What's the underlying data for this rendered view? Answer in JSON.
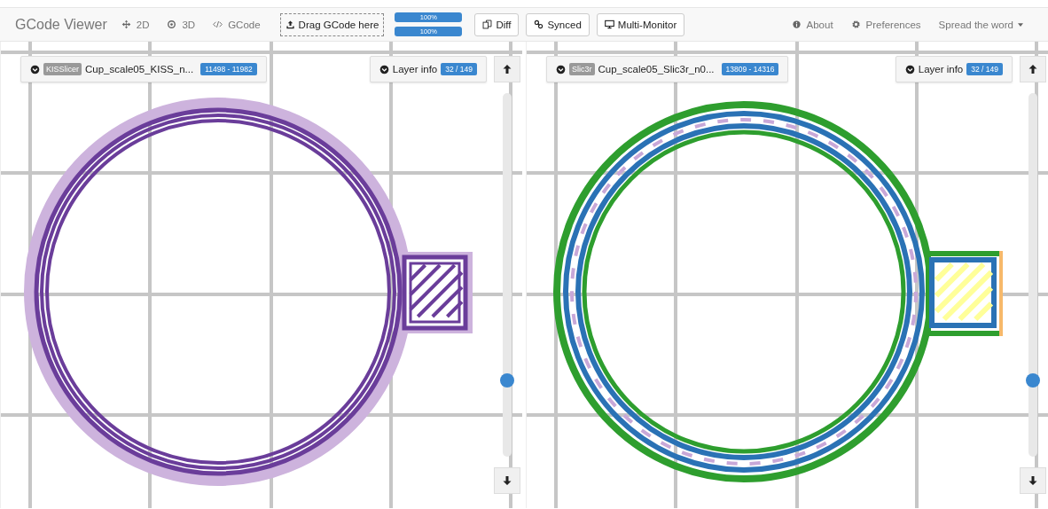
{
  "navbar": {
    "brand": "GCode Viewer",
    "nav_items": [
      {
        "label": "2D"
      },
      {
        "label": "3D"
      },
      {
        "label": "GCode"
      }
    ],
    "upload_button": "Drag GCode here",
    "progress_bars": [
      {
        "label": "100%",
        "level": 1
      },
      {
        "label": "100%",
        "level": 1
      }
    ],
    "buttons": [
      {
        "label": "Diff"
      },
      {
        "label": "Synced"
      },
      {
        "label": "Multi-Monitor"
      }
    ],
    "right_items": [
      {
        "label": "About",
        "dropdown": false
      },
      {
        "label": "Preferences",
        "dropdown": false
      },
      {
        "label": "Spread the word",
        "dropdown": true
      }
    ]
  },
  "panels": [
    {
      "kind": "single",
      "slicer": "KISSlicer",
      "filename": "Cup_scale05_KISS_n...",
      "range": "11498 - 11982",
      "layer_label": "Layer info",
      "layer": "32 / 149",
      "slider": {
        "level": 0.21
      }
    },
    {
      "kind": "typed",
      "slicer": "Slic3r",
      "filename": "Cup_scale05_Slic3r_n0...",
      "range": "13809 - 14316",
      "layer_label": "Layer info",
      "layer": "32 / 149",
      "slider": {
        "level": 0.21
      }
    }
  ]
}
